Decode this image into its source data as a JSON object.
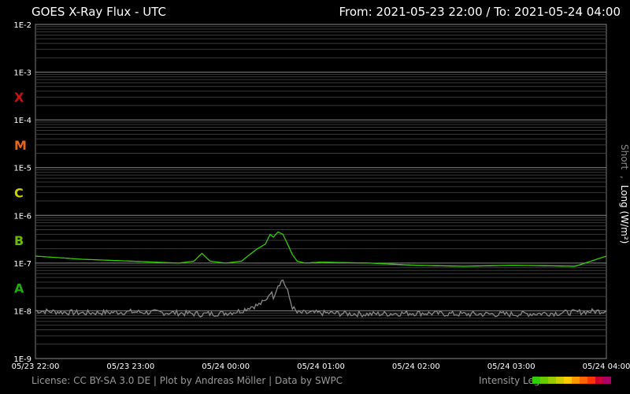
{
  "header": {
    "title": "GOES X-Ray Flux - UTC",
    "range": "From: 2021-05-23 22:00  /  To: 2021-05-24 04:00"
  },
  "footer": {
    "credits": "License: CC BY-SA 3.0 DE | Plot by Andreas Möller | Data by SWPC",
    "legend_label": "Intensity Leg"
  },
  "legend_colors": [
    "#33cc00",
    "#66cc00",
    "#99cc00",
    "#cccc00",
    "#ffcc00",
    "#ff9900",
    "#ff6600",
    "#ff3300",
    "#cc0033",
    "#aa0066"
  ],
  "chart_data": {
    "type": "line",
    "title": "GOES X-Ray Flux - UTC",
    "xlabel": "",
    "ylabel_short": "Short",
    "ylabel_sep": ",",
    "ylabel_long": "Long (W/m²)",
    "y_scale": "log",
    "ylim": [
      1e-09,
      0.01
    ],
    "grid": true,
    "y_ticks": [
      "1E-2",
      "1E-3",
      "1E-4",
      "1E-5",
      "1E-6",
      "1E-7",
      "1E-8",
      "1E-9"
    ],
    "x_ticks": [
      "05/23 22:00",
      "05/23 23:00",
      "05/24 00:00",
      "05/24 01:00",
      "05/24 02:00",
      "05/24 03:00",
      "05/24 04:00"
    ],
    "flare_classes": [
      {
        "label": "X",
        "flux": 0.0003,
        "color": "#cc1111"
      },
      {
        "label": "M",
        "flux": 3e-05,
        "color": "#e8661a"
      },
      {
        "label": "C",
        "flux": 3e-06,
        "color": "#cccc00"
      },
      {
        "label": "B",
        "flux": 3e-07,
        "color": "#66bb11"
      },
      {
        "label": "A",
        "flux": 3e-08,
        "color": "#22aa11"
      }
    ],
    "series": [
      {
        "name": "Long",
        "color": "#33cc00",
        "x": [
          "2021-05-23 22:00",
          "2021-05-23 22:30",
          "2021-05-23 23:00",
          "2021-05-23 23:30",
          "2021-05-23 23:40",
          "2021-05-23 23:45",
          "2021-05-23 23:50",
          "2021-05-24 00:00",
          "2021-05-24 00:10",
          "2021-05-24 00:15",
          "2021-05-24 00:20",
          "2021-05-24 00:25",
          "2021-05-24 00:28",
          "2021-05-24 00:30",
          "2021-05-24 00:33",
          "2021-05-24 00:36",
          "2021-05-24 00:39",
          "2021-05-24 00:42",
          "2021-05-24 00:45",
          "2021-05-24 00:50",
          "2021-05-24 01:00",
          "2021-05-24 01:30",
          "2021-05-24 02:00",
          "2021-05-24 02:30",
          "2021-05-24 03:00",
          "2021-05-24 03:20",
          "2021-05-24 03:40",
          "2021-05-24 04:00"
        ],
        "y": [
          1.4e-07,
          1.2e-07,
          1.1e-07,
          1e-07,
          1.1e-07,
          1.6e-07,
          1.1e-07,
          1e-07,
          1.1e-07,
          1.5e-07,
          2e-07,
          2.5e-07,
          4e-07,
          3.5e-07,
          4.5e-07,
          4e-07,
          2.5e-07,
          1.5e-07,
          1.1e-07,
          1e-07,
          1.05e-07,
          1e-07,
          9e-08,
          8.5e-08,
          9e-08,
          8.8e-08,
          8.5e-08,
          1.4e-07
        ]
      },
      {
        "name": "Short",
        "color": "#888888",
        "x": [
          "2021-05-23 22:00",
          "2021-05-23 22:30",
          "2021-05-23 23:00",
          "2021-05-23 23:30",
          "2021-05-23 23:45",
          "2021-05-24 00:00",
          "2021-05-24 00:10",
          "2021-05-24 00:15",
          "2021-05-24 00:20",
          "2021-05-24 00:25",
          "2021-05-24 00:28",
          "2021-05-24 00:30",
          "2021-05-24 00:33",
          "2021-05-24 00:36",
          "2021-05-24 00:39",
          "2021-05-24 00:42",
          "2021-05-24 00:45",
          "2021-05-24 01:00",
          "2021-05-24 01:30",
          "2021-05-24 02:00",
          "2021-05-24 02:30",
          "2021-05-24 03:00",
          "2021-05-24 03:30",
          "2021-05-24 04:00"
        ],
        "y": [
          1e-08,
          9e-09,
          9.5e-09,
          9e-09,
          8.5e-09,
          9e-09,
          1e-08,
          1.2e-08,
          1.3e-08,
          1.6e-08,
          2.5e-08,
          2e-08,
          3.5e-08,
          4.5e-08,
          2.5e-08,
          1.2e-08,
          9e-09,
          9e-09,
          8.5e-09,
          9e-09,
          8.5e-09,
          8.5e-09,
          9e-09,
          1e-08
        ]
      }
    ]
  }
}
